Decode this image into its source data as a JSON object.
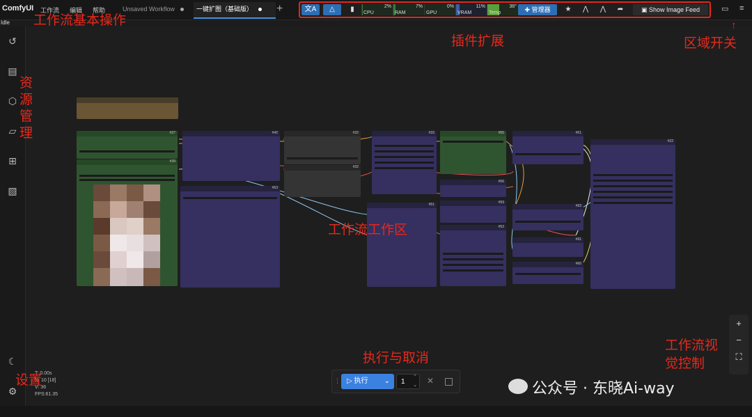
{
  "app": {
    "brand": "ComfyUI",
    "menu": [
      "工作流",
      "编辑",
      "帮助"
    ],
    "status": "Idle"
  },
  "tabs": [
    {
      "label": "Unsaved Workflow",
      "active": false
    },
    {
      "label": "一键扩图（基础版）",
      "active": true
    }
  ],
  "plugins": {
    "cpu": {
      "label": "CPU",
      "value": "2%",
      "percent": 2
    },
    "ram": {
      "label": "RAM",
      "value": "7%",
      "percent": 7
    },
    "gpu": {
      "label": "GPU",
      "value": "0%",
      "percent": 0
    },
    "vram": {
      "label": "VRAM",
      "value": "11%",
      "percent": 11
    },
    "temp": {
      "label": "Temp",
      "value": "38°",
      "percent": 38
    },
    "manager_label": "管理器",
    "feed_label": "Show Image Feed"
  },
  "nodes": {
    "n1": "#37",
    "n2": "#39",
    "n3": "#42",
    "n4": "#53",
    "n5": "#32",
    "n6": "#32",
    "n7": "#33",
    "n8": "#51",
    "n9": "#55",
    "n10": "#56",
    "n11": "#59",
    "n12": "#52",
    "n13": "#51",
    "n14": "#93",
    "n15": "#91",
    "n16": "#60",
    "n17": "#22"
  },
  "run": {
    "label": "执行",
    "count": "1"
  },
  "stats": [
    "T: 0.00s",
    "N: 10 [18]",
    "V: 36",
    "FPS:61.35"
  ],
  "annotations": {
    "basic_ops": "工作流基本操作",
    "plugins": "插件扩展",
    "region_toggle": "区域开关",
    "resources": "资源管理",
    "workspace": "工作流工作区",
    "run_cancel": "执行与取消",
    "visual_control": "工作流视觉控制",
    "settings": "设置"
  },
  "watermark": "公众号 · 东晓Ai-way",
  "colors": {
    "accent": "#3b82e0",
    "annotation": "#e8281c",
    "node_purple": "#353060",
    "node_green": "#2f5530"
  }
}
